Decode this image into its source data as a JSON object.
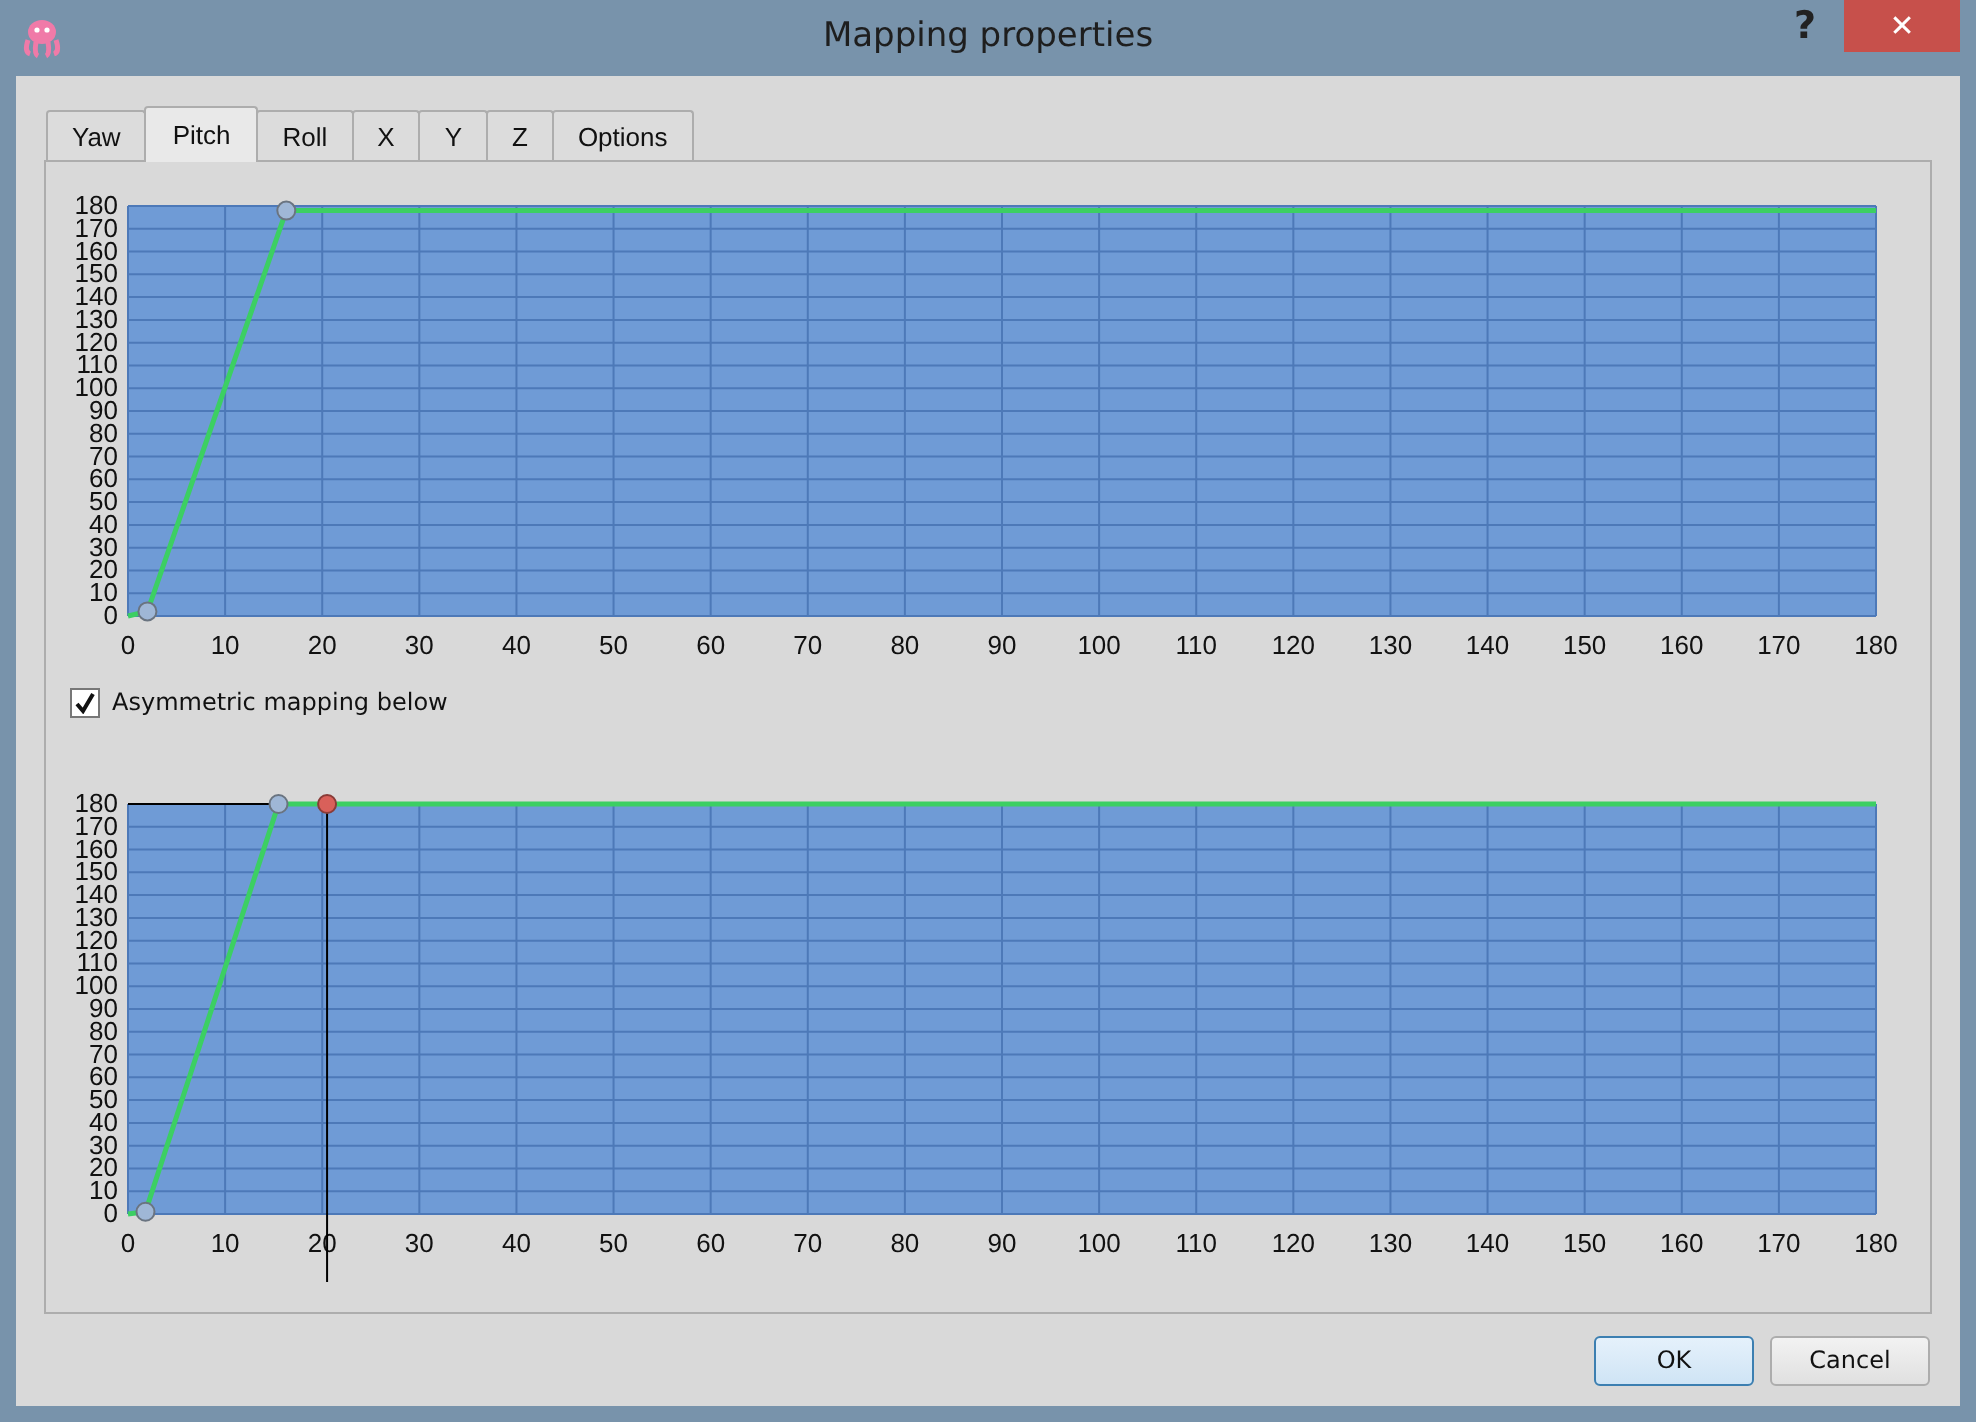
{
  "window": {
    "title": "Mapping properties",
    "help": "?",
    "close": "✕"
  },
  "tabs": [
    {
      "label": "Yaw",
      "selected": false
    },
    {
      "label": "Pitch",
      "selected": true
    },
    {
      "label": "Roll",
      "selected": false
    },
    {
      "label": "X",
      "selected": false
    },
    {
      "label": "Y",
      "selected": false
    },
    {
      "label": "Z",
      "selected": false
    },
    {
      "label": "Options",
      "selected": false
    }
  ],
  "main_mapping": {
    "chart_data": {
      "type": "line",
      "x": [
        0,
        2,
        16.3,
        180
      ],
      "grid": true,
      "series": [
        {
          "color": "#3ccf63",
          "values": [
            0,
            2,
            178,
            178
          ]
        }
      ],
      "xlim": [
        0,
        180
      ],
      "ylim": [
        0,
        180
      ],
      "xticks": [
        0,
        10,
        20,
        30,
        40,
        50,
        60,
        70,
        80,
        90,
        100,
        110,
        120,
        130,
        140,
        150,
        160,
        170,
        180
      ],
      "yticks": [
        0,
        10,
        20,
        30,
        40,
        50,
        60,
        70,
        80,
        90,
        100,
        110,
        120,
        130,
        140,
        150,
        160,
        170,
        180
      ]
    }
  },
  "asymmetric": {
    "label": "Asymmetric mapping below",
    "checked": true
  },
  "lower_mapping": {
    "chart_data": {
      "type": "line",
      "x": [
        0,
        1.8,
        15.5,
        180
      ],
      "grid": true,
      "series": [
        {
          "color": "#3ccf63",
          "values": [
            0,
            1,
            180,
            180
          ]
        }
      ],
      "xlim": [
        0,
        180
      ],
      "ylim": [
        0,
        180
      ],
      "xticks": [
        0,
        10,
        20,
        30,
        40,
        50,
        60,
        70,
        80,
        90,
        100,
        110,
        120,
        130,
        140,
        150,
        160,
        170,
        180
      ],
      "yticks": [
        0,
        10,
        20,
        30,
        40,
        50,
        60,
        70,
        80,
        90,
        100,
        110,
        120,
        130,
        140,
        150,
        160,
        170,
        180
      ],
      "ref_lines": [
        {
          "axis": "x",
          "value": 20.5
        },
        {
          "axis": "y",
          "value": 180
        }
      ]
    }
  },
  "buttons": [
    {
      "label": "OK",
      "default": true
    },
    {
      "label": "Cancel",
      "default": false
    }
  ]
}
